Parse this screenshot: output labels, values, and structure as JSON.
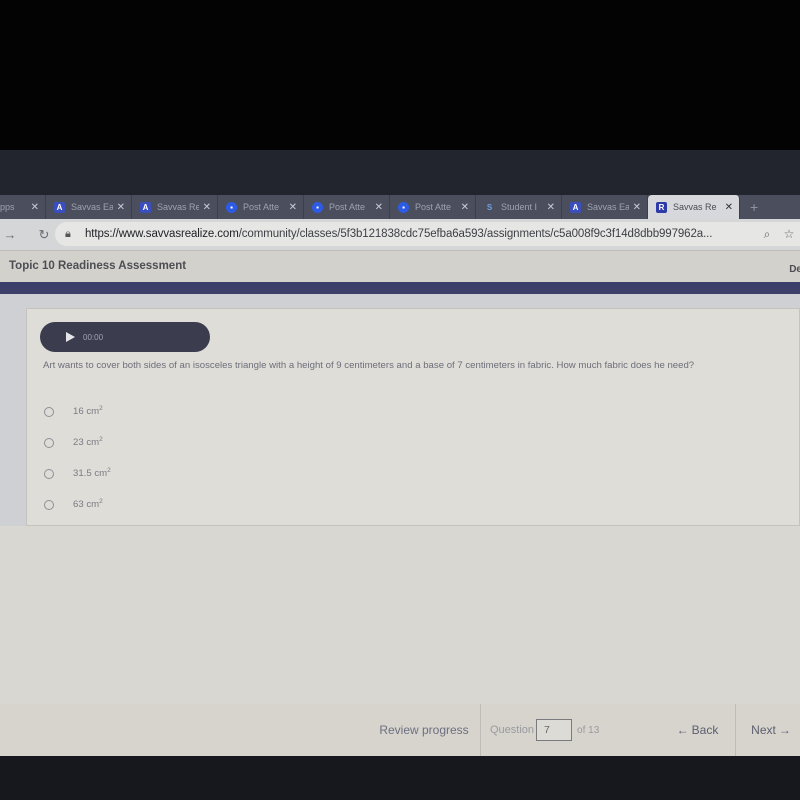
{
  "browser": {
    "tabs": [
      {
        "title": "pps",
        "icon": "apps-icon",
        "active": false
      },
      {
        "title": "Savvas Ea",
        "icon": "savvas-icon",
        "active": false
      },
      {
        "title": "Savvas Re",
        "icon": "savvas-icon",
        "active": false
      },
      {
        "title": "Post Atte",
        "icon": "zoom-icon",
        "active": false
      },
      {
        "title": "Post Atte",
        "icon": "zoom-icon",
        "active": false
      },
      {
        "title": "Post Atte",
        "icon": "zoom-icon",
        "active": false
      },
      {
        "title": "Student I",
        "icon": "student-icon",
        "active": false
      },
      {
        "title": "Savvas Ea",
        "icon": "savvas-icon",
        "active": false
      },
      {
        "title": "Savvas Re",
        "icon": "realize-icon",
        "active": true
      }
    ],
    "close_glyph": "✕",
    "new_tab_glyph": "+",
    "url_host": "https://www.savvasrealize.com",
    "url_path": "/community/classes/5f3b121838cdc75efba6a593/assignments/c5a008f9c3f14d8dbb997962a..."
  },
  "page": {
    "title": "Topic 10 Readiness Assessment",
    "header_right": "De"
  },
  "audio": {
    "time": "00:00"
  },
  "question": {
    "prompt": "Art wants to cover both sides of an isosceles triangle with a height of 9 centimeters and a base of 7 centimeters in fabric. How much fabric does he need?",
    "choices": [
      {
        "value": "16",
        "unit": "cm",
        "exp": "2"
      },
      {
        "value": "23",
        "unit": "cm",
        "exp": "2"
      },
      {
        "value": "31.5",
        "unit": "cm",
        "exp": "2"
      },
      {
        "value": "63",
        "unit": "cm",
        "exp": "2"
      }
    ]
  },
  "footer": {
    "review_label": "Review progress",
    "question_label": "Question",
    "question_number": "7",
    "of_label": "of 13",
    "back_label": "Back",
    "next_label": "Next"
  }
}
